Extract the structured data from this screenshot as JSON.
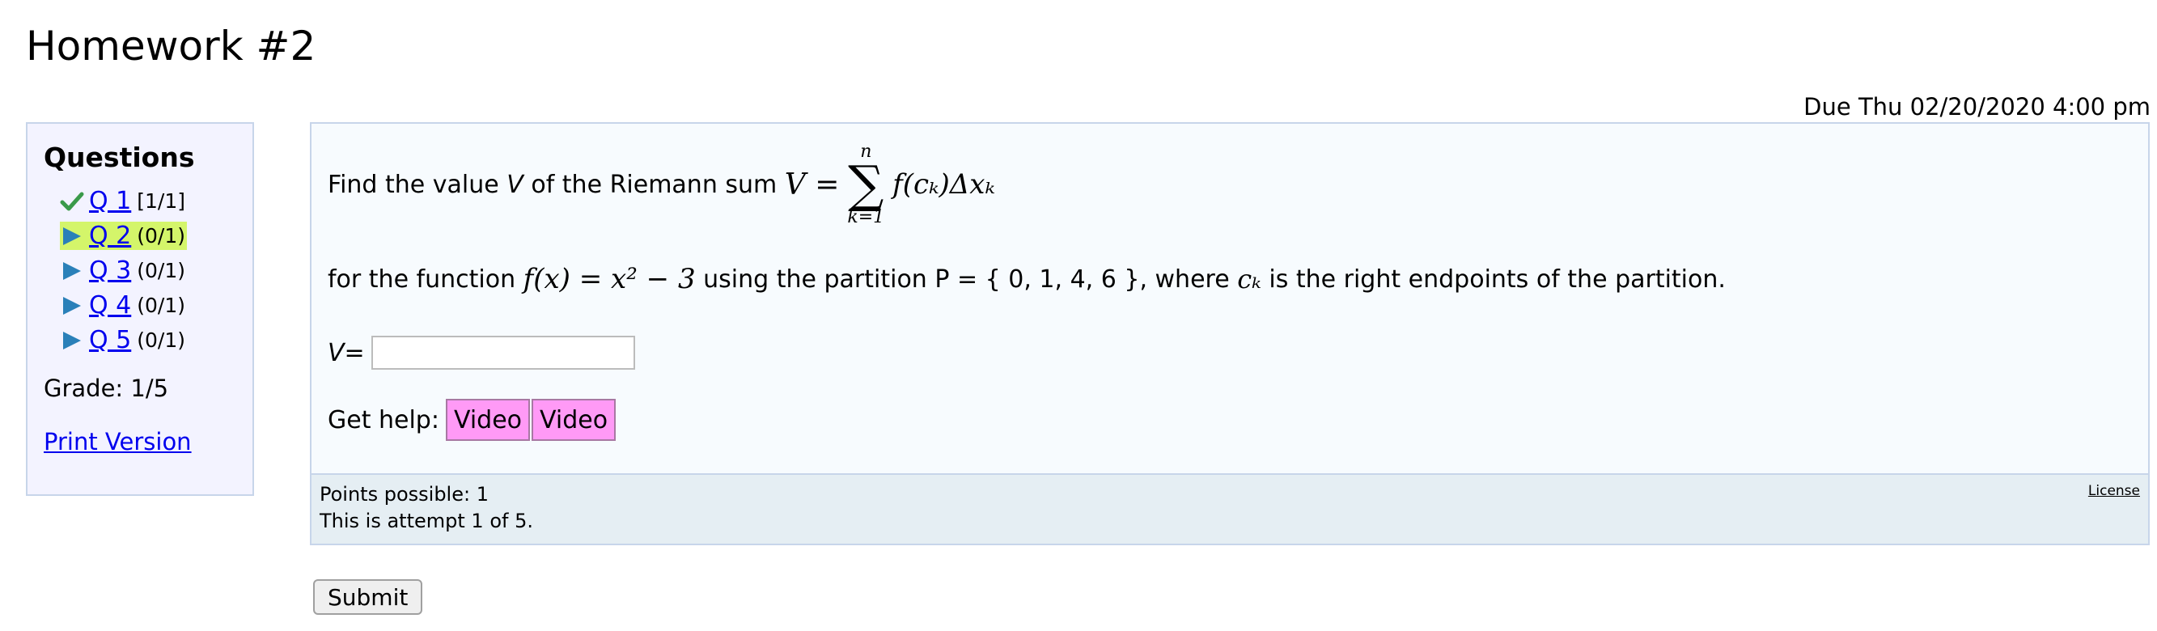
{
  "page": {
    "title": "Homework #2",
    "due": "Due Thu 02/20/2020 4:00 pm"
  },
  "sidebar": {
    "heading": "Questions",
    "questions": [
      {
        "label": "Q 1",
        "score": "[1/1]",
        "status": "correct",
        "icon": "checkmark-icon"
      },
      {
        "label": "Q 2",
        "score": "(0/1)",
        "status": "current",
        "icon": "play-arrow-icon"
      },
      {
        "label": "Q 3",
        "score": "(0/1)",
        "status": "unattempted",
        "icon": "play-arrow-icon"
      },
      {
        "label": "Q 4",
        "score": "(0/1)",
        "status": "unattempted",
        "icon": "play-arrow-icon"
      },
      {
        "label": "Q 5",
        "score": "(0/1)",
        "status": "unattempted",
        "icon": "play-arrow-icon"
      }
    ],
    "grade": "Grade: 1/5",
    "print_version": "Print Version"
  },
  "question": {
    "prompt_prefix": "Find the value",
    "var_v": "V",
    "prompt_mid": "of the Riemann sum",
    "sum_lhs": "V =",
    "sum_upper": "n",
    "sum_lower": "k=1",
    "sum_body": "f(cₖ)Δxₖ",
    "line2_prefix": "for the function",
    "function": "f(x) = x² − 3",
    "line2_mid": "using the partition P = { 0, 1, 4, 6 }, where",
    "ck": "cₖ",
    "line2_suffix": "is the right endpoints of the partition.",
    "answer_label_var": "V",
    "answer_label_eq": " =",
    "answer_value": "",
    "help_label": "Get help:",
    "help_buttons": [
      "Video",
      "Video"
    ],
    "points": "Points possible: 1",
    "attempt": "This is attempt 1 of 5.",
    "license": "License"
  },
  "actions": {
    "submit": "Submit"
  },
  "colors": {
    "check": "#3a9a4a",
    "arrow": "#2a80b9",
    "current_highlight": "#d4f56a",
    "video_button": "#ff9af6",
    "panel_bg": "#f3f3ff",
    "question_bg": "#f7fbfe",
    "footer_bg": "#e5eef3"
  }
}
